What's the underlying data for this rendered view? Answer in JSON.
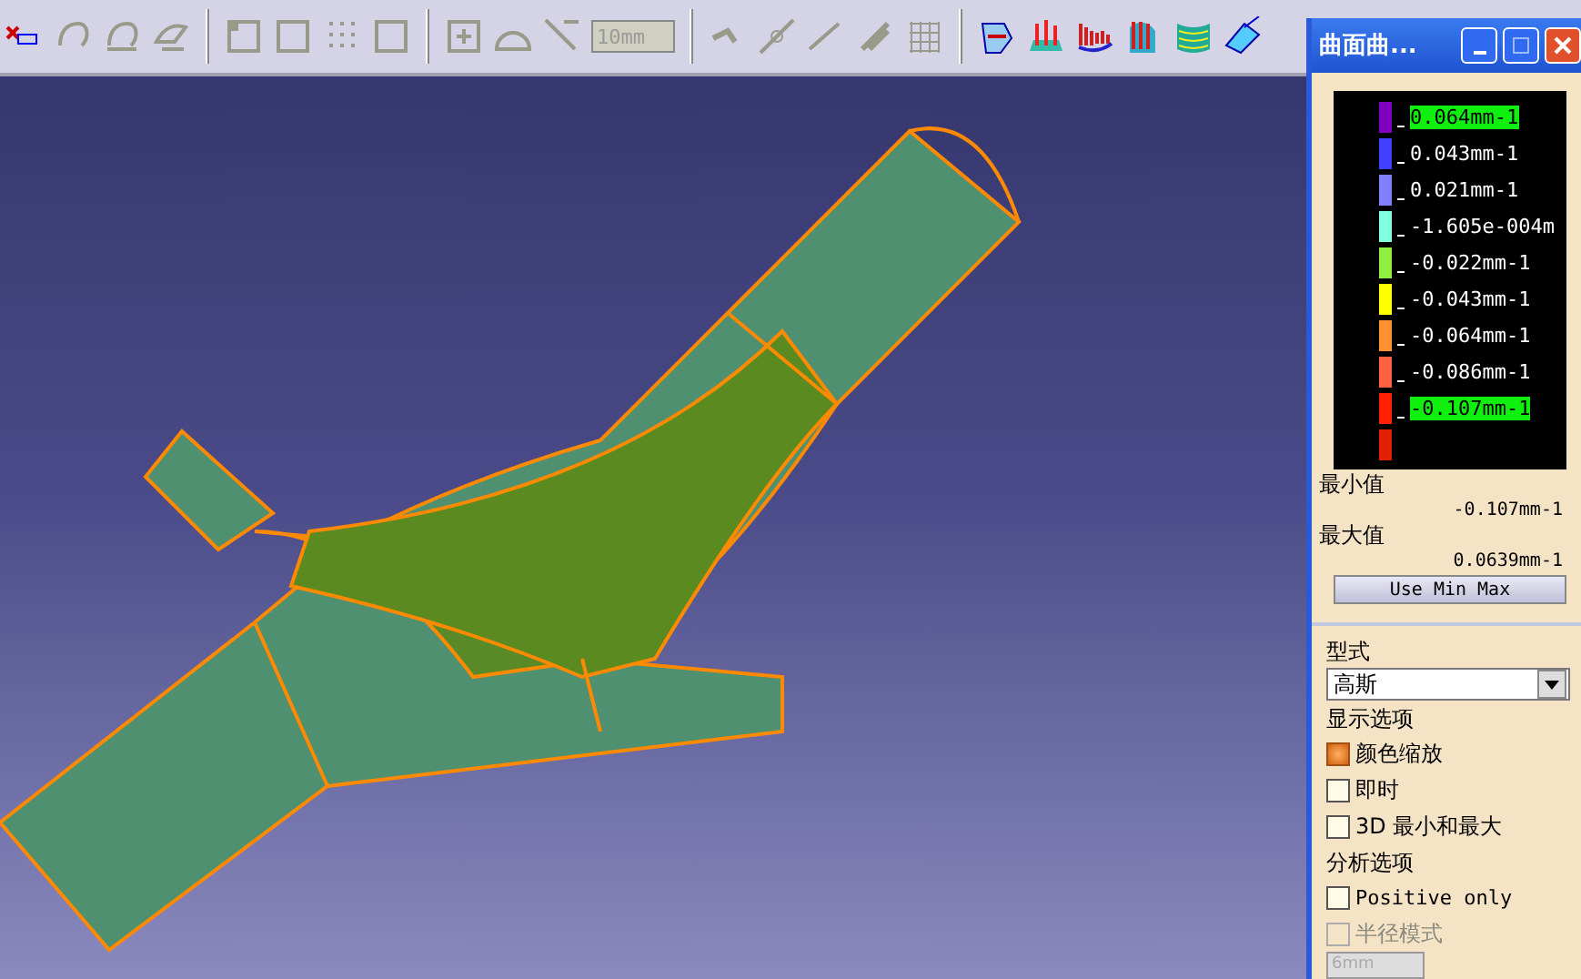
{
  "toolbar": {
    "spin_value": "10mm"
  },
  "analysis_window": {
    "title": "曲面曲...",
    "legend": [
      {
        "color": "#8000c0",
        "label": "0.064mm-1",
        "highlighted": true
      },
      {
        "color": "#4040ff",
        "label": "0.043mm-1",
        "highlighted": false
      },
      {
        "color": "#8080ff",
        "label": "0.021mm-1",
        "highlighted": false
      },
      {
        "color": "#80ffe0",
        "label": "-1.605e-004m",
        "highlighted": false
      },
      {
        "color": "#90f040",
        "label": "-0.022mm-1",
        "highlighted": false
      },
      {
        "color": "#ffff00",
        "label": "-0.043mm-1",
        "highlighted": false
      },
      {
        "color": "#ff9030",
        "label": "-0.064mm-1",
        "highlighted": false
      },
      {
        "color": "#ff6040",
        "label": "-0.086mm-1",
        "highlighted": false
      },
      {
        "color": "#ff2000",
        "label": "-0.107mm-1",
        "highlighted": true
      },
      {
        "color": "#e02000"
      }
    ],
    "min_label": "最小值",
    "min_value": "-0.107mm-1",
    "max_label": "最大值",
    "max_value": "0.0639mm-1",
    "button": "Use Min Max"
  },
  "options_panel": {
    "type_group": "型式",
    "type_value": "高斯",
    "display_group": "显示选项",
    "display_options": [
      {
        "label": "颜色缩放",
        "checked": true,
        "disabled": false
      },
      {
        "label": "即时",
        "checked": false,
        "disabled": false
      },
      {
        "label": "3D 最小和最大",
        "checked": false,
        "disabled": false
      }
    ],
    "analysis_group": "分析选项",
    "analysis_options": [
      {
        "label": "Positive only",
        "checked": false,
        "disabled": false
      },
      {
        "label": "半径模式",
        "checked": false,
        "disabled": true
      }
    ],
    "radius_value": "6mm"
  }
}
